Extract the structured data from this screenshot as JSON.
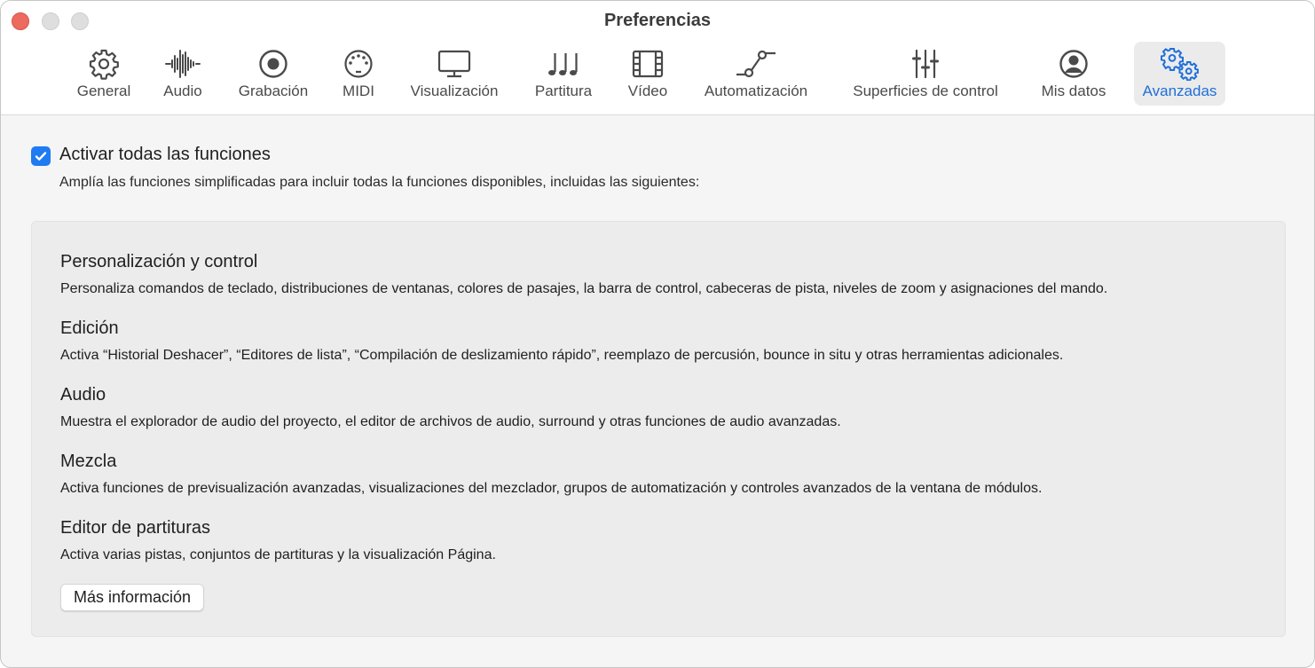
{
  "window": {
    "title": "Preferencias"
  },
  "toolbar": {
    "items": [
      {
        "label": "General",
        "icon": "gear-icon",
        "active": false
      },
      {
        "label": "Audio",
        "icon": "waveform-icon",
        "active": false
      },
      {
        "label": "Grabación",
        "icon": "record-icon",
        "active": false
      },
      {
        "label": "MIDI",
        "icon": "midi-connector-icon",
        "active": false
      },
      {
        "label": "Visualización",
        "icon": "display-icon",
        "active": false
      },
      {
        "label": "Partitura",
        "icon": "music-notes-icon",
        "active": false
      },
      {
        "label": "Vídeo",
        "icon": "film-strip-icon",
        "active": false
      },
      {
        "label": "Automatización",
        "icon": "automation-curve-icon",
        "active": false
      },
      {
        "label": "Superficies de control",
        "icon": "sliders-icon",
        "active": false
      },
      {
        "label": "Mis datos",
        "icon": "person-circle-icon",
        "active": false
      },
      {
        "label": "Avanzadas",
        "icon": "gears-icon",
        "active": true
      }
    ]
  },
  "main": {
    "enable_all": {
      "checked": true,
      "label": "Activar todas las funciones",
      "description": "Amplía las funciones simplificadas para incluir todas la funciones disponibles, incluidas las siguientes:"
    },
    "sections": [
      {
        "title": "Personalización y control",
        "description": "Personaliza comandos de teclado, distribuciones de ventanas, colores de pasajes, la barra de control, cabeceras de pista, niveles de zoom y asignaciones del mando."
      },
      {
        "title": "Edición",
        "description": "Activa “Historial Deshacer”, “Editores de lista”, “Compilación de deslizamiento rápido”, reemplazo de percusión, bounce in situ y otras herramientas adicionales."
      },
      {
        "title": "Audio",
        "description": "Muestra el explorador de audio del proyecto, el editor de archivos de audio, surround y otras funciones de audio avanzadas."
      },
      {
        "title": "Mezcla",
        "description": "Activa funciones de previsualización avanzadas, visualizaciones del mezclador, grupos de automatización y controles avanzados de la ventana de módulos."
      },
      {
        "title": "Editor de partituras",
        "description": "Activa varias pistas, conjuntos de partituras y la visualización Página."
      }
    ],
    "more_info_label": "Más información"
  },
  "colors": {
    "accent": "#1f7bf2",
    "active_label": "#1e6fd9",
    "close_button": "#ed6a5e"
  }
}
